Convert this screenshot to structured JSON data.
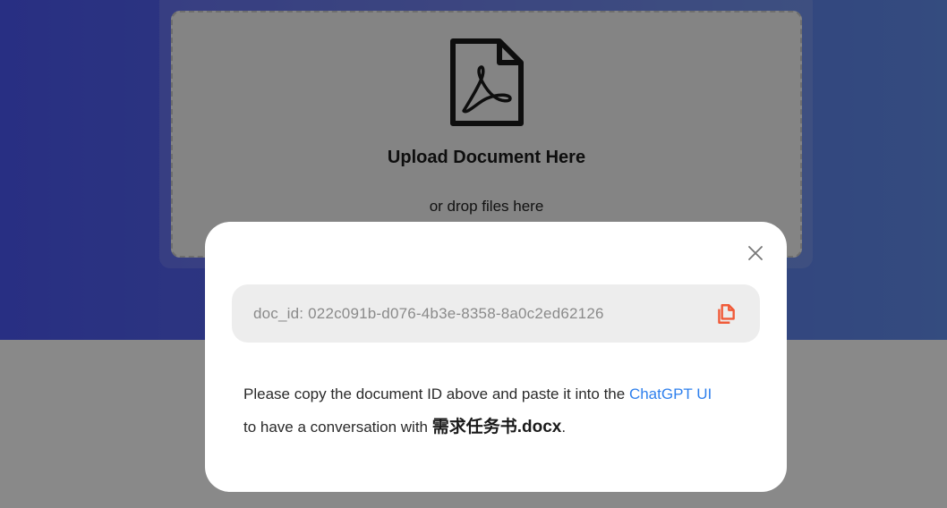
{
  "upload": {
    "title": "Upload Document Here",
    "subtitle": "or drop files here",
    "icon": "pdf-file-icon"
  },
  "modal": {
    "close_icon": "close-icon",
    "doc_id_text": "doc_id: 022c091b-d076-4b3e-8358-8a0c2ed62126",
    "copy_icon": "copy-icon",
    "message_part1": "Please copy the document ID above and paste it into the ",
    "link_text": "ChatGPT UI",
    "message_part2": "to have a conversation with ",
    "document_name": "需求任务书.docx",
    "message_end": "."
  },
  "colors": {
    "header_gradient_start": "#4a56ee",
    "header_gradient_end": "#5f8ae8",
    "link": "#2f80ed",
    "copy_icon": "#f05a38"
  }
}
